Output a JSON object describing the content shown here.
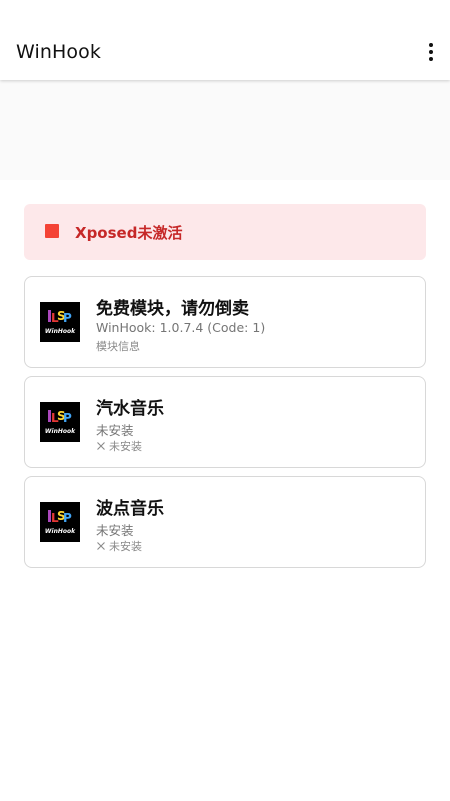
{
  "app": {
    "title": "WinHook",
    "more_icon": "more-vert-icon"
  },
  "alert": {
    "text": "Xposed未激活",
    "color": "#c62828",
    "background": "#fde8ea",
    "indicator_color": "#f44336"
  },
  "modules": [
    {
      "icon": "lsp-winhook-logo",
      "icon_caption": "WinHook",
      "title": "免费模块，请勿倒卖",
      "subtitle": "WinHook: 1.0.7.4 (Code: 1)",
      "status": "模块信息",
      "status_icon": ""
    },
    {
      "icon": "lsp-winhook-logo",
      "icon_caption": "WinHook",
      "title": "汽水音乐",
      "subtitle": "未安装",
      "status": "未安装",
      "status_icon": "close-icon"
    },
    {
      "icon": "lsp-winhook-logo",
      "icon_caption": "WinHook",
      "title": "波点音乐",
      "subtitle": "未安装",
      "status": "未安装",
      "status_icon": "close-icon"
    }
  ]
}
